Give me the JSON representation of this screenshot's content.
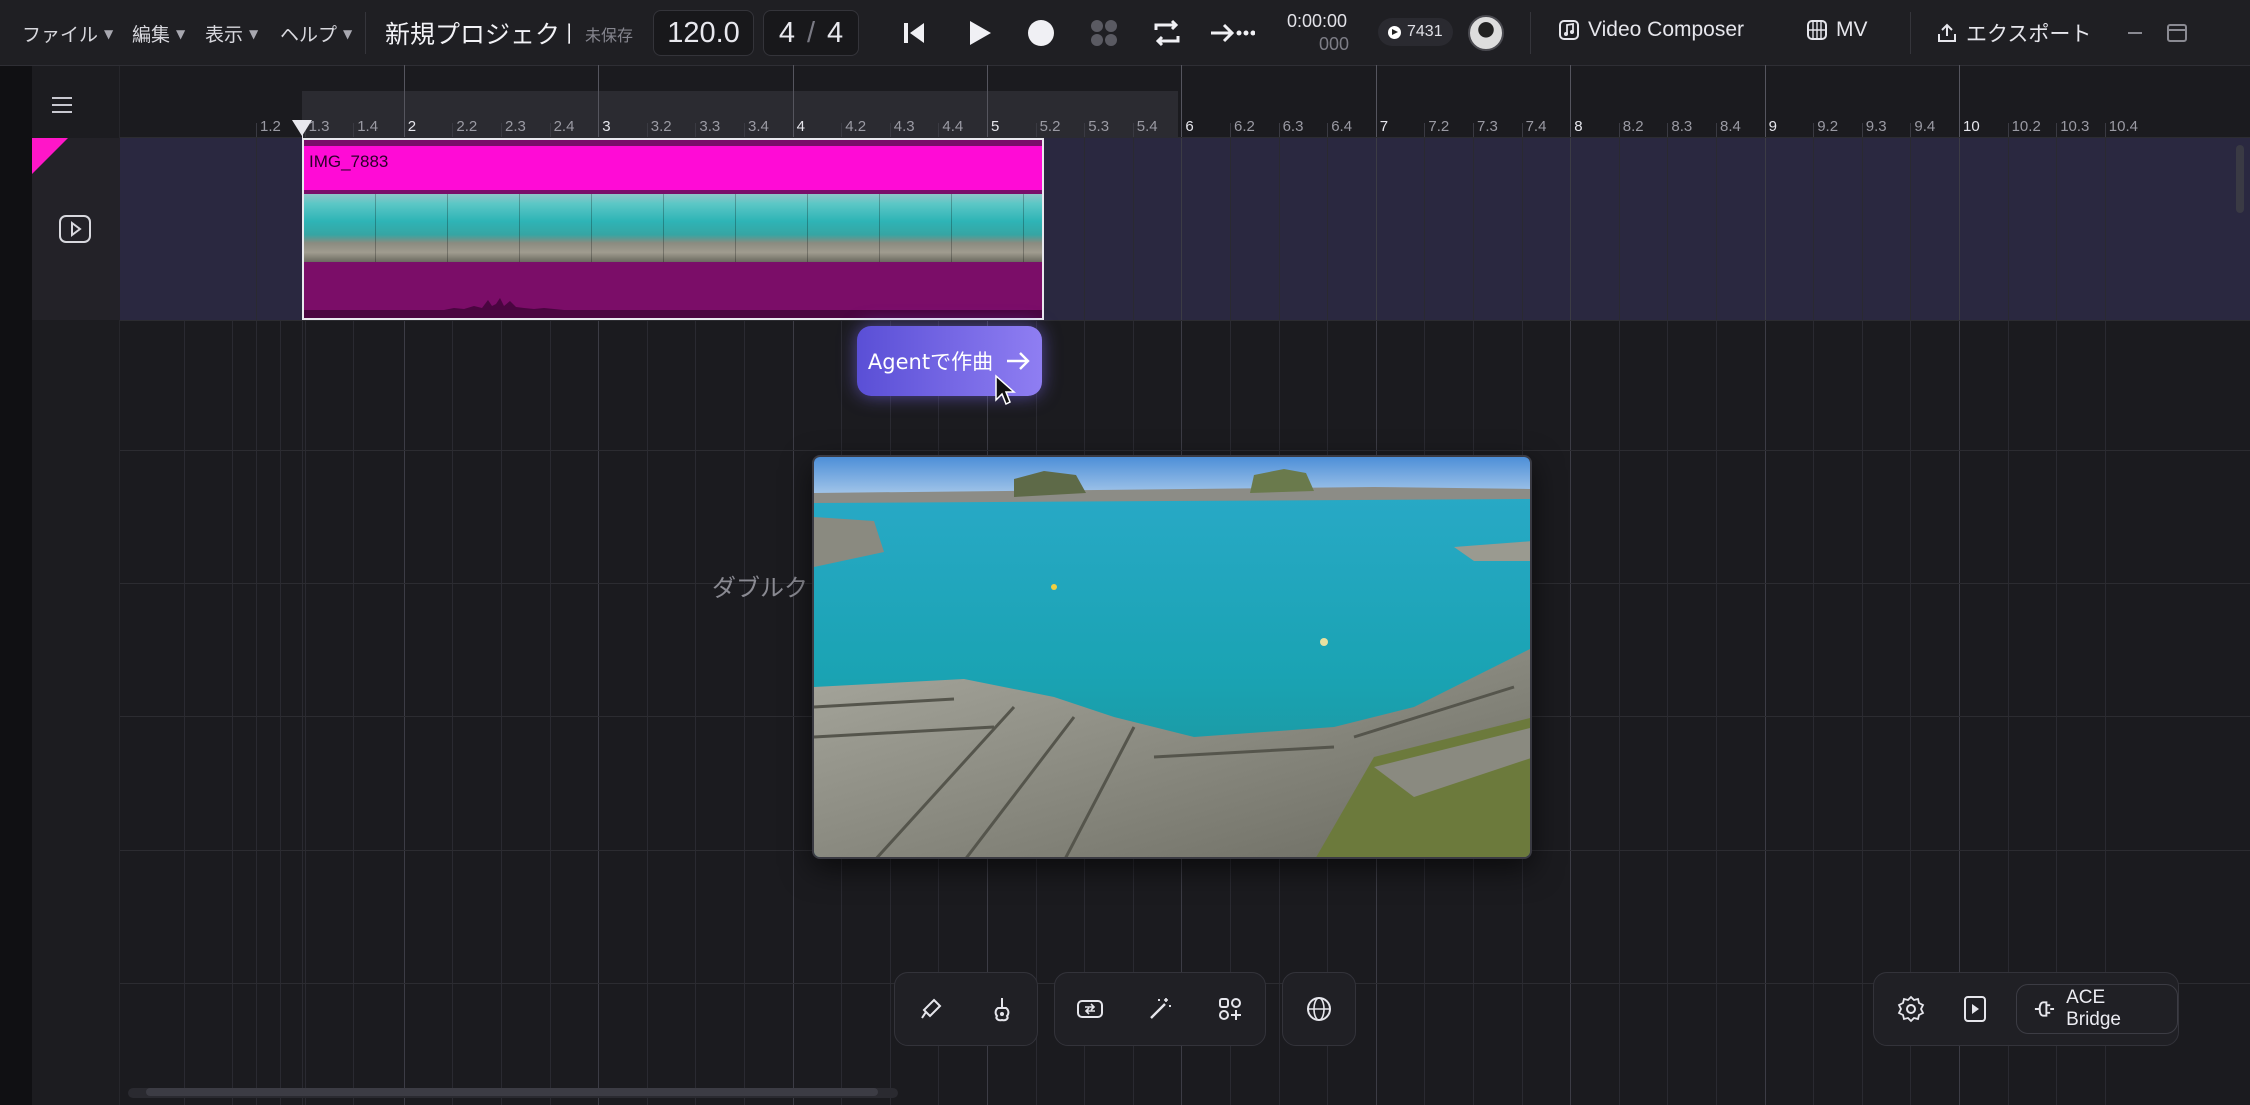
{
  "menu": [
    {
      "label": "ファイル"
    },
    {
      "label": "編集"
    },
    {
      "label": "表示"
    },
    {
      "label": "ヘルプ"
    }
  ],
  "project": {
    "title": "新規プロジェクト",
    "status": "未保存"
  },
  "transport": {
    "tempo": "120.0",
    "time_sig_num": "4",
    "time_sig_den": "4",
    "time_main": "0:00:00",
    "time_sub": "000"
  },
  "credits": "7431",
  "nav": {
    "video_composer": "Video Composer",
    "mv": "MV",
    "export": "エクスポート"
  },
  "ruler": {
    "ticks": [
      "1.2",
      "1.3",
      "1.4",
      "2",
      "2.2",
      "2.3",
      "2.4",
      "3",
      "3.2",
      "3.3",
      "3.4",
      "4",
      "4.2",
      "4.3",
      "4.4",
      "5",
      "5.2",
      "5.3",
      "5.4",
      "6",
      "6.2",
      "6.3",
      "6.4",
      "7",
      "7.2",
      "7.3",
      "7.4",
      "8",
      "8.2",
      "8.3",
      "8.4",
      "9",
      "9.2",
      "9.3",
      "9.4",
      "10",
      "10.2",
      "10.3",
      "10.4"
    ]
  },
  "clip": {
    "name": "IMG_7883"
  },
  "agent": {
    "label": "Agentで作曲"
  },
  "hint": "ダブルク",
  "bottom": {
    "ace_bridge": "ACE Bridge"
  },
  "colors": {
    "accent_pink": "#ff0bd6",
    "agent_gradient_start": "#5a4fd6",
    "agent_gradient_end": "#8f7ef2",
    "track_bg": "#2a2840"
  },
  "icons": [
    "previous-icon",
    "play-icon",
    "record-icon",
    "metronome-dots-icon",
    "loop-icon",
    "arrow-dots-icon",
    "music-note-icon",
    "globe-grid-icon",
    "export-icon",
    "minimize-icon",
    "maximize-icon",
    "hamburger-icon",
    "video-play-icon",
    "brush-icon",
    "guitar-icon",
    "swap-icon",
    "magic-wand-icon",
    "add-widget-icon",
    "globe-icon",
    "settings-icon",
    "video-file-icon",
    "plug-icon"
  ]
}
